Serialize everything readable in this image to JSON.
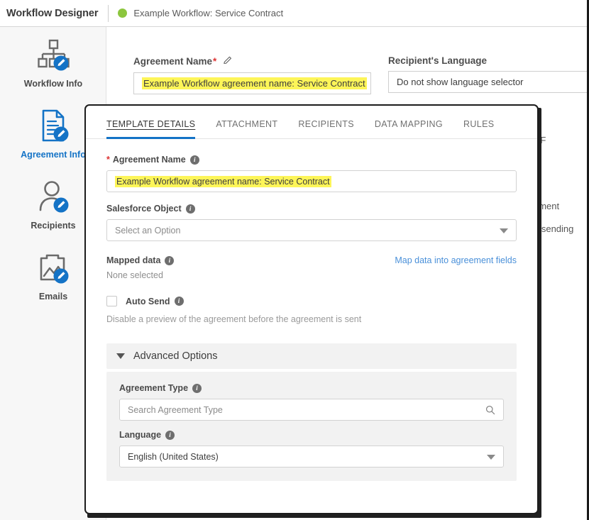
{
  "header": {
    "app_title": "Workflow Designer",
    "workflow_name": "Example Workflow: Service Contract",
    "status_dot_color": "#8cc63e"
  },
  "sidebar": {
    "items": [
      {
        "label": "Workflow Info",
        "icon": "org-chart-icon",
        "active": false
      },
      {
        "label": "Agreement Info",
        "icon": "document-icon",
        "active": true
      },
      {
        "label": "Recipients",
        "icon": "person-icon",
        "active": false
      },
      {
        "label": "Emails",
        "icon": "image-icon",
        "active": false
      }
    ]
  },
  "background_form": {
    "agreement_name": {
      "label": "Agreement Name",
      "required_marker": "*",
      "edit_icon": "pencil-icon",
      "value": "Example Workflow agreement name: Service Contract"
    },
    "recipients_language": {
      "label": "Recipient's Language",
      "value": "Do not show language selector"
    },
    "occluded_fragments": [
      "DF",
      "ement",
      "o sending"
    ]
  },
  "modal": {
    "tabs": [
      {
        "label": "TEMPLATE DETAILS",
        "active": true
      },
      {
        "label": "ATTACHMENT",
        "active": false
      },
      {
        "label": "RECIPIENTS",
        "active": false
      },
      {
        "label": "DATA MAPPING",
        "active": false
      },
      {
        "label": "RULES",
        "active": false
      }
    ],
    "agreement_name": {
      "label": "Agreement Name",
      "required_marker": "*",
      "info": "i",
      "value": "Example Workflow agreement name: Service Contract"
    },
    "salesforce_object": {
      "label": "Salesforce Object",
      "info": "i",
      "value": "Select an Option"
    },
    "mapped_data": {
      "label": "Mapped data",
      "info": "i",
      "link": "Map data into agreement fields",
      "value": "None selected"
    },
    "auto_send": {
      "label": "Auto Send",
      "info": "i",
      "checked": false,
      "help": "Disable a preview of the agreement before the agreement is sent"
    },
    "advanced_options": {
      "title": "Advanced Options",
      "expanded": true,
      "agreement_type": {
        "label": "Agreement Type",
        "info": "i",
        "placeholder": "Search Agreement Type",
        "value": ""
      },
      "language": {
        "label": "Language",
        "info": "i",
        "value": "English (United States)"
      }
    }
  },
  "colors": {
    "accent_blue": "#1473c6",
    "link_blue": "#4a90d9",
    "highlight_yellow": "#fdf558",
    "required_red": "#dd3333"
  }
}
